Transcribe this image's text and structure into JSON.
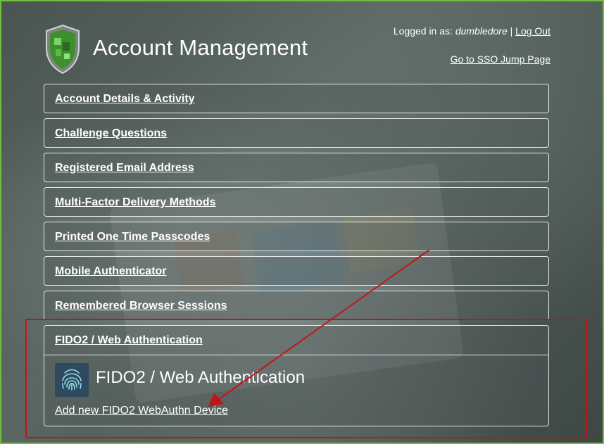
{
  "header": {
    "title": "Account Management",
    "logged_in_prefix": "Logged in as:",
    "username": "dumbledore",
    "separator": "|",
    "logout_label": "Log Out",
    "sso_link": "Go to SSO Jump Page"
  },
  "menu": [
    {
      "label": "Account Details & Activity"
    },
    {
      "label": "Challenge Questions"
    },
    {
      "label": "Registered Email Address"
    },
    {
      "label": "Multi-Factor Delivery Methods"
    },
    {
      "label": "Printed One Time Passcodes"
    },
    {
      "label": "Mobile Authenticator"
    },
    {
      "label": "Remembered Browser Sessions"
    }
  ],
  "fido": {
    "menu_label": "FIDO2 / Web Authentication",
    "heading": "FIDO2 / Web Authentication",
    "icon": "fingerprint-icon",
    "add_link": "Add new FIDO2 WebAuthn Device"
  },
  "colors": {
    "frame_border": "#6fbf3a",
    "annotation": "#c0161b",
    "shield_green": "#3f8f2c"
  }
}
